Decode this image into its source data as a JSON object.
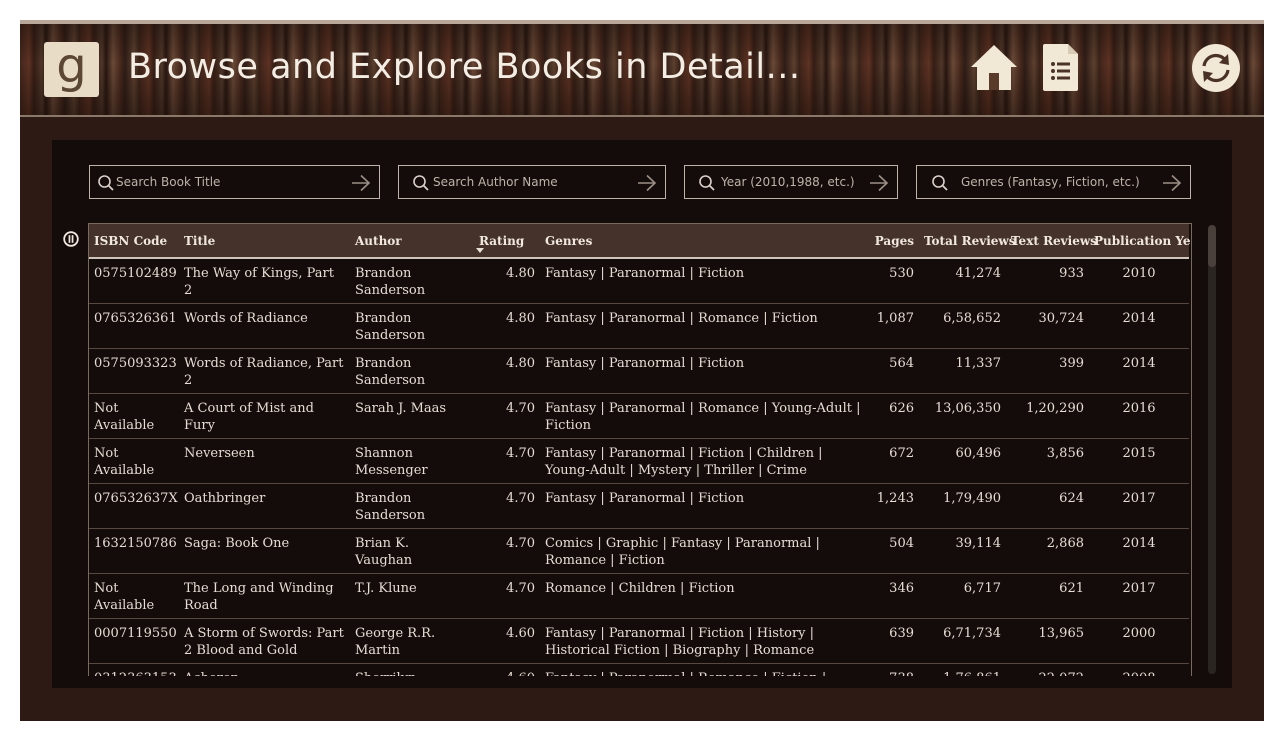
{
  "header": {
    "logo_letter": "g",
    "title": "Browse and Explore Books in Detail...",
    "icons": [
      "home-icon",
      "list-icon",
      "refresh-icon"
    ]
  },
  "search": {
    "title_placeholder": "Search Book Title",
    "author_placeholder": "Search Author Name",
    "year_placeholder": "Year (2010,1988, etc.)",
    "genre_placeholder": "Genres (Fantasy, Fiction, etc.)"
  },
  "table": {
    "columns": [
      "ISBN Code",
      "Title",
      "Author",
      "Rating",
      "Genres",
      "Pages",
      "Total Reviews",
      "Text Reviews",
      "Publication Year"
    ],
    "sorted_by": "Rating",
    "sort_direction": "descending",
    "rows": [
      {
        "isbn": "0575102489",
        "title": "The Way of Kings, Part 2",
        "author": "Brandon Sanderson",
        "rating": "4.80",
        "genres": "Fantasy | Paranormal | Fiction",
        "pages": "530",
        "total_reviews": "41,274",
        "text_reviews": "933",
        "year": "2010"
      },
      {
        "isbn": "0765326361",
        "title": "Words of Radiance",
        "author": "Brandon Sanderson",
        "rating": "4.80",
        "genres": "Fantasy | Paranormal | Romance | Fiction",
        "pages": "1,087",
        "total_reviews": "6,58,652",
        "text_reviews": "30,724",
        "year": "2014"
      },
      {
        "isbn": "0575093323",
        "title": "Words of Radiance, Part 2",
        "author": "Brandon Sanderson",
        "rating": "4.80",
        "genres": "Fantasy | Paranormal | Fiction",
        "pages": "564",
        "total_reviews": "11,337",
        "text_reviews": "399",
        "year": "2014"
      },
      {
        "isbn": "Not Available",
        "title": "A Court of Mist and Fury",
        "author": "Sarah J. Maas",
        "rating": "4.70",
        "genres": "Fantasy | Paranormal | Romance | Young-Adult | Fiction",
        "pages": "626",
        "total_reviews": "13,06,350",
        "text_reviews": "1,20,290",
        "year": "2016"
      },
      {
        "isbn": "Not Available",
        "title": "Neverseen",
        "author": "Shannon Messenger",
        "rating": "4.70",
        "genres": "Fantasy | Paranormal | Fiction | Children | Young-Adult | Mystery | Thriller | Crime",
        "pages": "672",
        "total_reviews": "60,496",
        "text_reviews": "3,856",
        "year": "2015"
      },
      {
        "isbn": "076532637X",
        "title": "Oathbringer",
        "author": "Brandon Sanderson",
        "rating": "4.70",
        "genres": "Fantasy | Paranormal | Fiction",
        "pages": "1,243",
        "total_reviews": "1,79,490",
        "text_reviews": "624",
        "year": "2017"
      },
      {
        "isbn": "1632150786",
        "title": "Saga: Book One",
        "author": "Brian K. Vaughan",
        "rating": "4.70",
        "genres": "Comics | Graphic | Fantasy | Paranormal | Romance | Fiction",
        "pages": "504",
        "total_reviews": "39,114",
        "text_reviews": "2,868",
        "year": "2014"
      },
      {
        "isbn": "Not Available",
        "title": "The Long and Winding Road",
        "author": "T.J. Klune",
        "rating": "4.70",
        "genres": "Romance | Children | Fiction",
        "pages": "346",
        "total_reviews": "6,717",
        "text_reviews": "621",
        "year": "2017"
      },
      {
        "isbn": "0007119550",
        "title": "A Storm of Swords: Part 2 Blood and Gold",
        "author": "George R.R. Martin",
        "rating": "4.60",
        "genres": "Fantasy | Paranormal | Fiction | History | Historical Fiction | Biography | Romance",
        "pages": "639",
        "total_reviews": "6,71,734",
        "text_reviews": "13,965",
        "year": "2000"
      },
      {
        "isbn": "0312363153",
        "title": "Acheron",
        "author": "Sherrilyn Kenyon",
        "rating": "4.60",
        "genres": "Fantasy | Paranormal | Romance | Fiction | History |",
        "pages": "738",
        "total_reviews": "1,76,861",
        "text_reviews": "22,072",
        "year": "2008"
      }
    ]
  }
}
